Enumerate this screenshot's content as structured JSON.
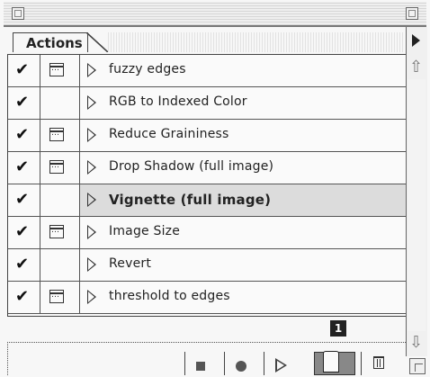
{
  "panel": {
    "tab_label": "Actions",
    "status_number": "1"
  },
  "actions": [
    {
      "label": "fuzzy edges",
      "checked": true,
      "dialog": true
    },
    {
      "label": "RGB to Indexed Color",
      "checked": true,
      "dialog": false
    },
    {
      "label": "Reduce Graininess",
      "checked": true,
      "dialog": true
    },
    {
      "label": "Drop Shadow (full image)",
      "checked": true,
      "dialog": true
    },
    {
      "label": "Vignette (full image)",
      "checked": true,
      "dialog": false,
      "selected": true
    },
    {
      "label": "Image Size",
      "checked": true,
      "dialog": true
    },
    {
      "label": "Revert",
      "checked": true,
      "dialog": false
    },
    {
      "label": "threshold to edges",
      "checked": true,
      "dialog": true
    }
  ],
  "glyphs": {
    "check": "✔",
    "scroll_up": "⇧",
    "scroll_down": "⇩"
  },
  "toolbar": {
    "buttons": [
      "stop-icon",
      "record-icon",
      "play-icon",
      "new-action-icon",
      "trash-icon"
    ]
  }
}
